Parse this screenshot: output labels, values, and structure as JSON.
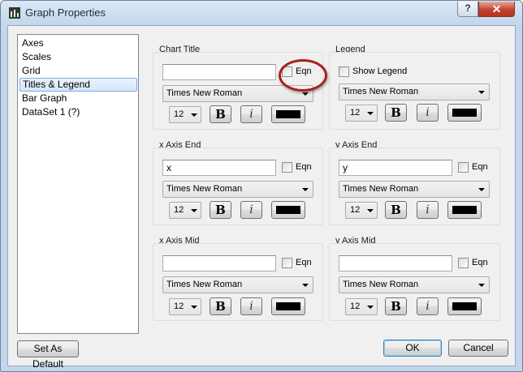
{
  "window": {
    "title": "Graph Properties",
    "help": "?"
  },
  "sidebar": {
    "items": [
      {
        "label": "Axes"
      },
      {
        "label": "Scales"
      },
      {
        "label": "Grid"
      },
      {
        "label": "Titles & Legend",
        "selected": true
      },
      {
        "label": "Bar Graph"
      },
      {
        "label": "DataSet 1 (?)"
      }
    ]
  },
  "chart_title": {
    "label": "Chart Title",
    "value": "",
    "eqn_label": "Eqn",
    "font": "Times New Roman",
    "size": "12",
    "bold": "B",
    "italic": "i",
    "color": "#000000"
  },
  "legend": {
    "label": "Legend",
    "show_label": "Show Legend",
    "font": "Times New Roman",
    "size": "12",
    "bold": "B",
    "italic": "i",
    "color": "#000000"
  },
  "x_axis_end": {
    "label": "x Axis End",
    "value": "x",
    "eqn_label": "Eqn",
    "font": "Times New Roman",
    "size": "12",
    "bold": "B",
    "italic": "i",
    "color": "#000000"
  },
  "y_axis_end": {
    "label": "y Axis End",
    "value": "y",
    "eqn_label": "Eqn",
    "font": "Times New Roman",
    "size": "12",
    "bold": "B",
    "italic": "i",
    "color": "#000000"
  },
  "x_axis_mid": {
    "label": "x Axis Mid",
    "value": "",
    "eqn_label": "Eqn",
    "font": "Times New Roman",
    "size": "12",
    "bold": "B",
    "italic": "i",
    "color": "#000000"
  },
  "y_axis_mid": {
    "label": "y Axis Mid",
    "value": "",
    "eqn_label": "Eqn",
    "font": "Times New Roman",
    "size": "12",
    "bold": "B",
    "italic": "i",
    "color": "#000000"
  },
  "footer": {
    "set_default": "Set As Default",
    "ok": "OK",
    "cancel": "Cancel"
  },
  "colors": {
    "highlight": "#a8201a",
    "close_button": "#c2452d",
    "selection": "#d5e6fa"
  }
}
